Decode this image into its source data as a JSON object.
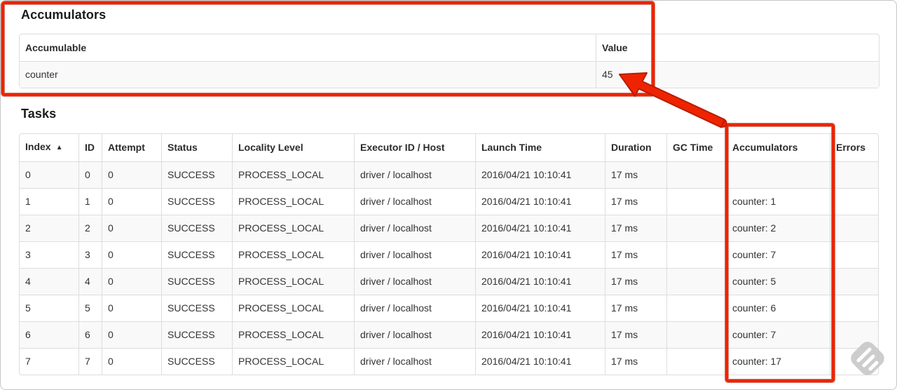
{
  "accumulators_section": {
    "heading": "Accumulators",
    "table": {
      "headers": {
        "accumulable": "Accumulable",
        "value": "Value"
      },
      "row": {
        "accumulable": "counter",
        "value": "45"
      }
    }
  },
  "tasks_section": {
    "heading": "Tasks",
    "table": {
      "headers": {
        "index": "Index",
        "sort_icon": "▲",
        "id": "ID",
        "attempt": "Attempt",
        "status": "Status",
        "locality": "Locality Level",
        "executor": "Executor ID / Host",
        "launch": "Launch Time",
        "duration": "Duration",
        "gc": "GC Time",
        "accumulators": "Accumulators",
        "errors": "Errors"
      },
      "rows": [
        {
          "index": "0",
          "id": "0",
          "attempt": "0",
          "status": "SUCCESS",
          "locality": "PROCESS_LOCAL",
          "executor": "driver / localhost",
          "launch": "2016/04/21 10:10:41",
          "duration": "17 ms",
          "gc": "",
          "accumulators": "",
          "errors": ""
        },
        {
          "index": "1",
          "id": "1",
          "attempt": "0",
          "status": "SUCCESS",
          "locality": "PROCESS_LOCAL",
          "executor": "driver / localhost",
          "launch": "2016/04/21 10:10:41",
          "duration": "17 ms",
          "gc": "",
          "accumulators": "counter: 1",
          "errors": ""
        },
        {
          "index": "2",
          "id": "2",
          "attempt": "0",
          "status": "SUCCESS",
          "locality": "PROCESS_LOCAL",
          "executor": "driver / localhost",
          "launch": "2016/04/21 10:10:41",
          "duration": "17 ms",
          "gc": "",
          "accumulators": "counter: 2",
          "errors": ""
        },
        {
          "index": "3",
          "id": "3",
          "attempt": "0",
          "status": "SUCCESS",
          "locality": "PROCESS_LOCAL",
          "executor": "driver / localhost",
          "launch": "2016/04/21 10:10:41",
          "duration": "17 ms",
          "gc": "",
          "accumulators": "counter: 7",
          "errors": ""
        },
        {
          "index": "4",
          "id": "4",
          "attempt": "0",
          "status": "SUCCESS",
          "locality": "PROCESS_LOCAL",
          "executor": "driver / localhost",
          "launch": "2016/04/21 10:10:41",
          "duration": "17 ms",
          "gc": "",
          "accumulators": "counter: 5",
          "errors": ""
        },
        {
          "index": "5",
          "id": "5",
          "attempt": "0",
          "status": "SUCCESS",
          "locality": "PROCESS_LOCAL",
          "executor": "driver / localhost",
          "launch": "2016/04/21 10:10:41",
          "duration": "17 ms",
          "gc": "",
          "accumulators": "counter: 6",
          "errors": ""
        },
        {
          "index": "6",
          "id": "6",
          "attempt": "0",
          "status": "SUCCESS",
          "locality": "PROCESS_LOCAL",
          "executor": "driver / localhost",
          "launch": "2016/04/21 10:10:41",
          "duration": "17 ms",
          "gc": "",
          "accumulators": "counter: 7",
          "errors": ""
        },
        {
          "index": "7",
          "id": "7",
          "attempt": "0",
          "status": "SUCCESS",
          "locality": "PROCESS_LOCAL",
          "executor": "driver / localhost",
          "launch": "2016/04/21 10:10:41",
          "duration": "17 ms",
          "gc": "",
          "accumulators": "counter: 17",
          "errors": ""
        }
      ]
    }
  },
  "annotations": {
    "accent_color": "#ee2400",
    "outline_color": "#b81c00",
    "watermark_color": "#c5c5c5"
  }
}
